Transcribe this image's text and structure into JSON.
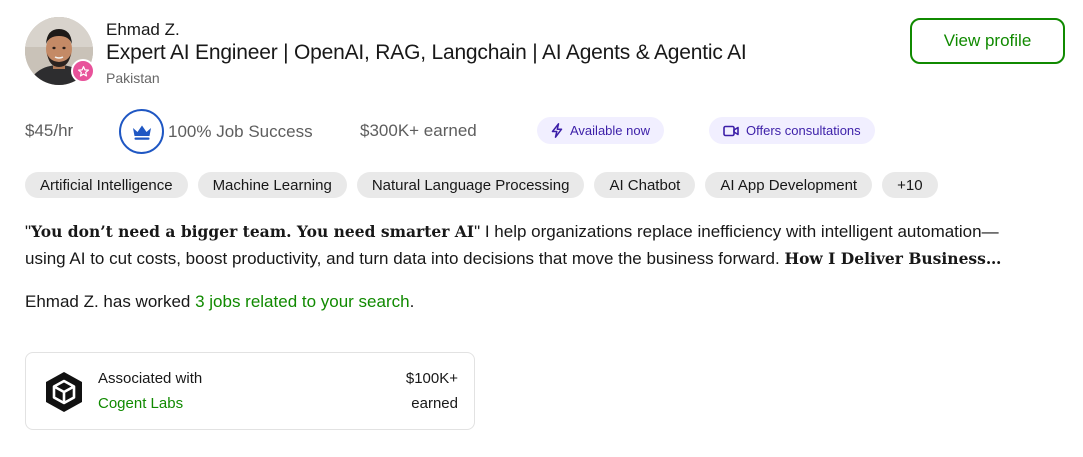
{
  "freelancer": {
    "name": "Ehmad Z.",
    "title": "Expert AI Engineer | OpenAI, RAG, Langchain | AI Agents & Agentic AI",
    "location": "Pakistan"
  },
  "actions": {
    "view_profile_label": "View profile"
  },
  "stats": {
    "rate": "$45/hr",
    "job_success": "100% Job Success",
    "earned": "$300K+ earned",
    "available": "Available now",
    "consultations": "Offers consultations"
  },
  "skills": [
    "Artificial Intelligence",
    "Machine Learning",
    "Natural Language Processing",
    "AI Chatbot",
    "AI App Development",
    "+10"
  ],
  "description": {
    "quote_open": "\"",
    "quote_bold": "You don’t need a bigger team. You need smarter AI",
    "quote_close": "\"",
    "line1_rest": " I help organizations replace inefficiency with intelligent automation—",
    "line2": "using AI to cut costs, boost productivity, and turn data into decisions that move the business forward. ",
    "line2_bold": "How I Deliver Business…"
  },
  "history": {
    "prefix": "Ehmad Z. has worked ",
    "link": "3 jobs related to your search",
    "suffix": "."
  },
  "association": {
    "label": "Associated with",
    "company": "Cogent Labs",
    "amount": "$100K+",
    "earned_label": "earned"
  },
  "colors": {
    "brand_green": "#108a00",
    "job_success_blue": "#1f57c3",
    "badge_pink": "#e8529a",
    "pill_purple_bg": "#f1efff",
    "pill_purple_text": "#3c1fa8",
    "skill_bg": "#e9e9e9"
  },
  "icons": {
    "avatar_badge": "star-icon",
    "job_success": "crown-icon",
    "available": "lightning-bolt-icon",
    "consultations": "video-camera-icon",
    "company_logo": "cube-logo-icon"
  }
}
